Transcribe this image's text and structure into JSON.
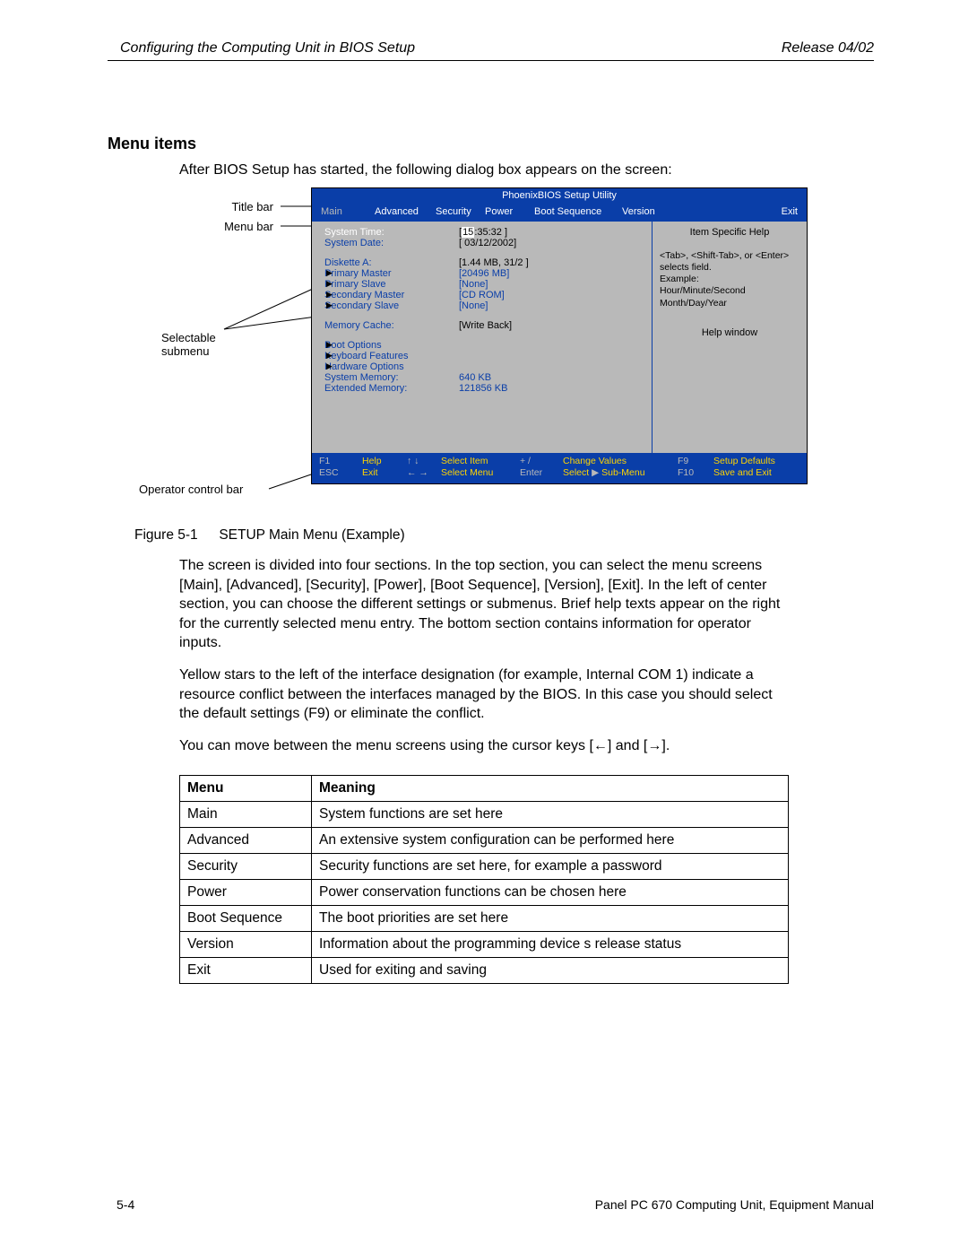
{
  "header": {
    "left": "Configuring the Computing Unit in BIOS Setup",
    "right": "Release 04/02"
  },
  "section_title": "Menu items",
  "intro": "After BIOS Setup has started, the following dialog box appears on the screen:",
  "callouts": {
    "titlebar": "Title bar",
    "menubar": "Menu bar",
    "submenu1": "Selectable",
    "submenu2": "submenu",
    "helpwin": "Help window",
    "opbar": "Operator control bar"
  },
  "bios": {
    "title": "PhoenixBIOS Setup Utility",
    "menus": {
      "main": "Main",
      "adv": "Advanced",
      "sec": "Security",
      "pow": "Power",
      "boot": "Boot Sequence",
      "ver": "Version",
      "exit": "Exit"
    },
    "rows": {
      "time_l": "System Time:",
      "time_v_a": "[",
      "time_v_hl": "15",
      "time_v_b": ":35:32 ]",
      "date_l": "System Date:",
      "date_v": "[ 03/12/2002]",
      "diska_l": "Diskette A:",
      "diska_v": "[1.44 MB, 31/2 ]",
      "pm_l": "Primary Master",
      "pm_v": "[20496 MB]",
      "ps_l": "Primary Slave",
      "ps_v": "[None]",
      "sm_l": "Secondary Master",
      "sm_v": "[CD  ROM]",
      "ss_l": "Secondary Slave",
      "ss_v": "[None]",
      "mc_l": "Memory Cache:",
      "mc_v": "[Write Back]",
      "bo_l": "Boot Options",
      "kf_l": "Keyboard Features",
      "ho_l": "Hardware Options",
      "sysm_l": "System Memory:",
      "sysm_v": "640 KB",
      "extm_l": "Extended Memory:",
      "extm_v": "121856 KB"
    },
    "help": {
      "title": "Item Specific Help",
      "body": "<Tab>, <Shift-Tab>, or <Enter> selects field.\nExample:\n  Hour/Minute/Second\n  Month/Day/Year"
    },
    "footer": {
      "f1": "F1",
      "help": "Help",
      "esc": "ESC",
      "exit": "Exit",
      "ud": "↑ ↓",
      "lr": "← →",
      "seli": "Select Item",
      "selm": "Select Menu",
      "pm": "+ /",
      "ent": "Enter",
      "chg": "Change Values",
      "selsub_a": "Select ",
      "selsub_b": " Sub-Menu",
      "f9": "F9",
      "f10": "F10",
      "sdef": "Setup Defaults",
      "save": "Save and Exit"
    }
  },
  "fig": {
    "num": "Figure 5-1",
    "cap": "SETUP Main Menu (Example)"
  },
  "p1": "The screen is divided into four sections. In the top section, you can select the menu screens [Main], [Advanced], [Security], [Power], [Boot Sequence], [Version], [Exit]. In the left of center section, you can choose the different settings or submenus. Brief help texts appear on the right for the currently selected menu entry. The bottom section contains information for operator inputs.",
  "p2": "Yellow stars to the left of the interface designation (for example, Internal COM 1) indicate a resource conflict between the interfaces managed by the BIOS. In this case you should select the default settings (F9) or eliminate the conflict.",
  "p3": "You can move between the menu screens using the cursor keys [←] and [→].",
  "table": {
    "h1": "Menu",
    "h2": "Meaning",
    "rows": [
      {
        "m": "Main",
        "d": "System functions are set here"
      },
      {
        "m": "Advanced",
        "d": "An extensive system configuration can be performed here"
      },
      {
        "m": "Security",
        "d": "Security functions are set here, for example a password"
      },
      {
        "m": "Power",
        "d": "Power conservation functions can be chosen here"
      },
      {
        "m": "Boot Sequence",
        "d": "The boot priorities are set here"
      },
      {
        "m": "Version",
        "d": "Information about the programming device s release status"
      },
      {
        "m": "Exit",
        "d": "Used for exiting and saving"
      }
    ]
  },
  "footer": {
    "left": "5-4",
    "right": "Panel PC 670 Computing Unit, Equipment Manual"
  }
}
